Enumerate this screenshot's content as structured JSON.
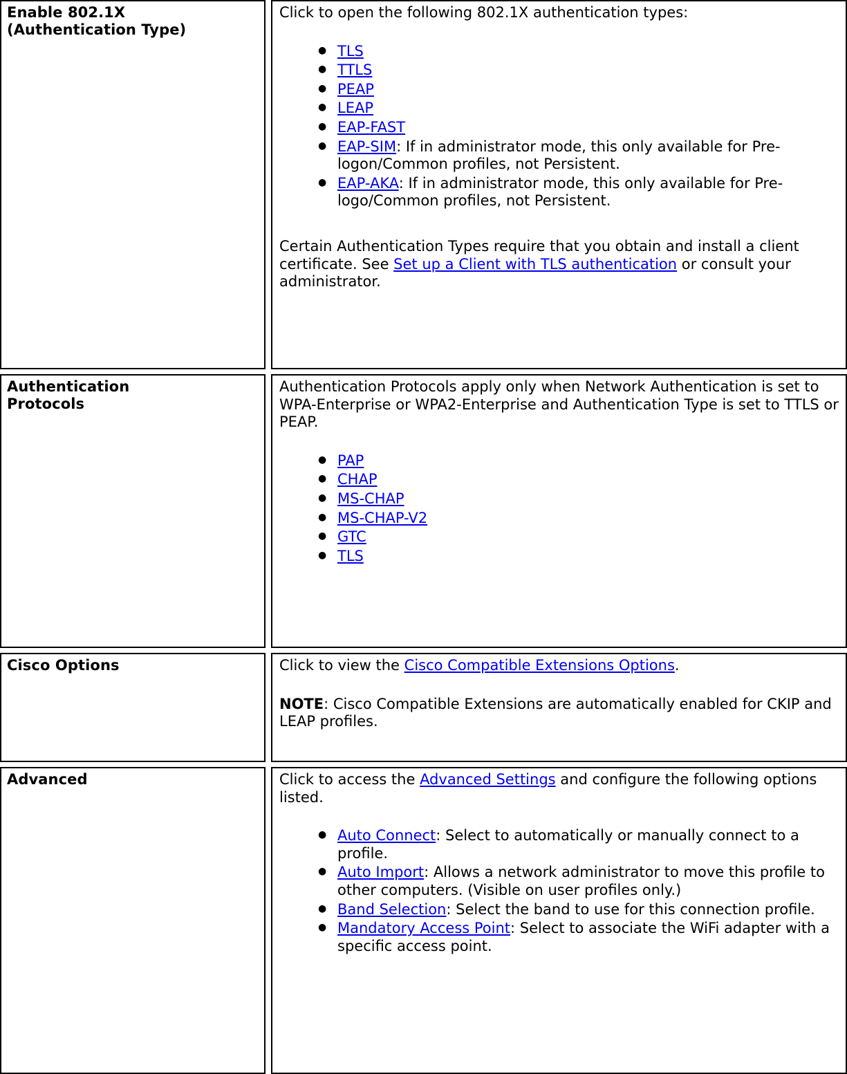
{
  "document": {
    "type": "definition-table",
    "link_color": "#0000ee",
    "text_color": "#000000",
    "rows": [
      {
        "id": "enable-8021x",
        "term": "Enable 802.1X (Authentication Type)",
        "term_line_1": "Enable 802.1X",
        "term_line_2": "(Authentication Type)",
        "intro": "Click to open the following 802.1X authentication types:",
        "bullets": [
          {
            "link": "TLS",
            "text": ""
          },
          {
            "link": "TTLS",
            "text": ""
          },
          {
            "link": "PEAP",
            "text": ""
          },
          {
            "link": "LEAP",
            "text": ""
          },
          {
            "link": "EAP-FAST",
            "text": ""
          },
          {
            "link": "EAP-SIM",
            "text": ": If in administrator mode, this only available for Pre-logon/Common profiles, not Persistent."
          },
          {
            "link": "EAP-AKA",
            "text": ": If in administrator mode, this only available for Pre-logo/Common profiles, not Persistent."
          }
        ],
        "closing_before_link": "Certain Authentication Types require that you obtain and install a client certificate. See ",
        "closing_link": "Set up a Client with TLS authentication",
        "closing_after_link": " or consult your administrator."
      },
      {
        "id": "authentication-protocols",
        "term": "Authentication Protocols",
        "term_line_1": "Authentication",
        "term_line_2": "Protocols",
        "intro": "Authentication Protocols apply only when Network Authentication is set to WPA-Enterprise or WPA2-Enterprise and Authentication Type is set to TTLS or PEAP.",
        "bullets": [
          {
            "link": "PAP",
            "text": ""
          },
          {
            "link": "CHAP",
            "text": ""
          },
          {
            "link": "MS-CHAP",
            "text": ""
          },
          {
            "link": "MS-CHAP-V2",
            "text": ""
          },
          {
            "link": "GTC",
            "text": ""
          },
          {
            "link": "TLS",
            "text": ""
          }
        ]
      },
      {
        "id": "cisco-options",
        "term": "Cisco Options",
        "intro_before_link": "Click to view the ",
        "intro_link": "Cisco Compatible Extensions Options",
        "intro_after_link": ".",
        "note_label": "NOTE",
        "note_text": ": Cisco Compatible Extensions are automatically enabled for CKIP and LEAP profiles."
      },
      {
        "id": "advanced",
        "term": "Advanced",
        "intro_before_link": "Click to access the ",
        "intro_link": "Advanced Settings",
        "intro_after_link": " and configure the following options listed.",
        "bullets": [
          {
            "link": "Auto Connect",
            "text": ": Select to automatically or manually connect to a profile."
          },
          {
            "link": "Auto Import",
            "text": ": Allows a network administrator to move this profile to other computers. (Visible on user profiles only.)"
          },
          {
            "link": "Band Selection",
            "text": ": Select the band to use for this connection profile."
          },
          {
            "link": "Mandatory Access Point",
            "text": ": Select to associate the WiFi adapter with a specific access point."
          }
        ]
      }
    ]
  }
}
